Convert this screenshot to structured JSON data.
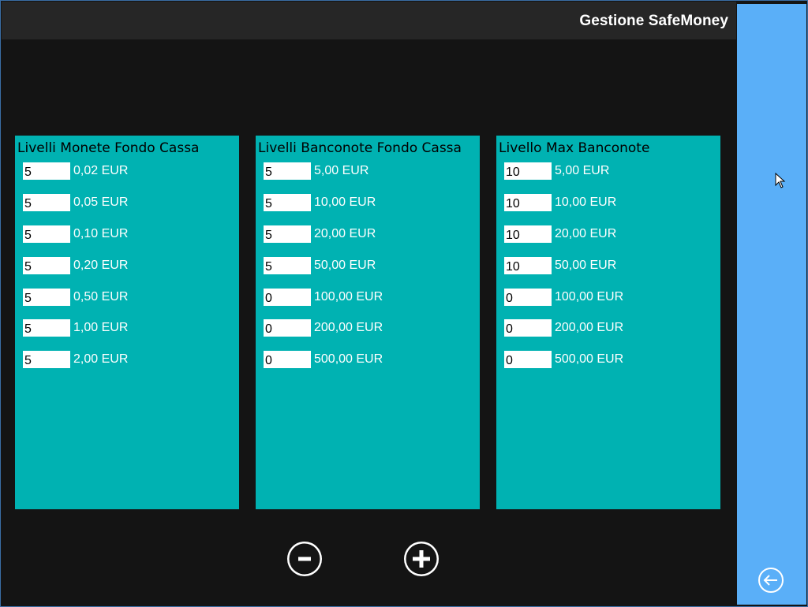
{
  "app": {
    "title": "Gestione SafeMoney",
    "accent_color": "#5aaff8",
    "panel_color": "#00b2b2"
  },
  "panels": [
    {
      "title": "Livelli Monete Fondo Cassa",
      "rows": [
        {
          "value": "5",
          "label": "0,02 EUR"
        },
        {
          "value": "5",
          "label": "0,05 EUR"
        },
        {
          "value": "5",
          "label": "0,10 EUR"
        },
        {
          "value": "5",
          "label": "0,20 EUR"
        },
        {
          "value": "5",
          "label": "0,50 EUR"
        },
        {
          "value": "5",
          "label": "1,00 EUR"
        },
        {
          "value": "5",
          "label": "2,00 EUR"
        }
      ]
    },
    {
      "title": "Livelli Banconote Fondo Cassa",
      "rows": [
        {
          "value": "5",
          "label": "5,00 EUR"
        },
        {
          "value": "5",
          "label": "10,00 EUR"
        },
        {
          "value": "5",
          "label": "20,00 EUR"
        },
        {
          "value": "5",
          "label": "50,00 EUR"
        },
        {
          "value": "0",
          "label": "100,00 EUR"
        },
        {
          "value": "0",
          "label": "200,00 EUR"
        },
        {
          "value": "0",
          "label": "500,00 EUR"
        }
      ]
    },
    {
      "title": "Livello Max Banconote",
      "rows": [
        {
          "value": "10",
          "label": "5,00 EUR"
        },
        {
          "value": "10",
          "label": "10,00 EUR"
        },
        {
          "value": "10",
          "label": "20,00 EUR"
        },
        {
          "value": "10",
          "label": "50,00 EUR"
        },
        {
          "value": "0",
          "label": "100,00 EUR"
        },
        {
          "value": "0",
          "label": "200,00 EUR"
        },
        {
          "value": "0",
          "label": "500,00 EUR"
        }
      ]
    }
  ],
  "controls": {
    "minus_icon": "minus-circle-icon",
    "plus_icon": "plus-circle-icon",
    "back_icon": "back-arrow-circle-icon"
  }
}
